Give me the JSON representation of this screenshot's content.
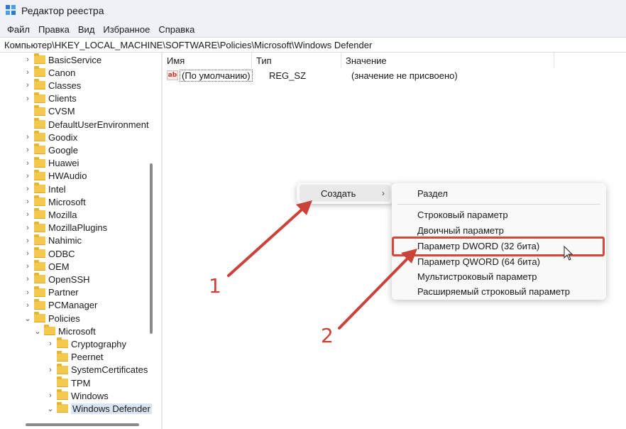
{
  "window": {
    "title": "Редактор реестра"
  },
  "menu": [
    "Файл",
    "Правка",
    "Вид",
    "Избранное",
    "Справка"
  ],
  "address": "Компьютер\\HKEY_LOCAL_MACHINE\\SOFTWARE\\Policies\\Microsoft\\Windows Defender",
  "tree": {
    "level1": [
      {
        "label": "BasicService",
        "expandable": true
      },
      {
        "label": "Canon",
        "expandable": true
      },
      {
        "label": "Classes",
        "expandable": true
      },
      {
        "label": "Clients",
        "expandable": true
      },
      {
        "label": "CVSM",
        "expandable": false
      },
      {
        "label": "DefaultUserEnvironment",
        "expandable": false
      },
      {
        "label": "Goodix",
        "expandable": true
      },
      {
        "label": "Google",
        "expandable": true
      },
      {
        "label": "Huawei",
        "expandable": true
      },
      {
        "label": "HWAudio",
        "expandable": true
      },
      {
        "label": "Intel",
        "expandable": true
      },
      {
        "label": "Microsoft",
        "expandable": true
      },
      {
        "label": "Mozilla",
        "expandable": true
      },
      {
        "label": "MozillaPlugins",
        "expandable": true
      },
      {
        "label": "Nahimic",
        "expandable": true
      },
      {
        "label": "ODBC",
        "expandable": true
      },
      {
        "label": "OEM",
        "expandable": true
      },
      {
        "label": "OpenSSH",
        "expandable": true
      },
      {
        "label": "Partner",
        "expandable": true
      },
      {
        "label": "PCManager",
        "expandable": true
      },
      {
        "label": "Policies",
        "expandable": true,
        "expanded": true
      }
    ],
    "level2": [
      {
        "label": "Microsoft",
        "expanded": true
      }
    ],
    "level3": [
      {
        "label": "Cryptography",
        "expandable": true
      },
      {
        "label": "Peernet",
        "expandable": false
      },
      {
        "label": "SystemCertificates",
        "expandable": true
      },
      {
        "label": "TPM",
        "expandable": false
      },
      {
        "label": "Windows",
        "expandable": true
      },
      {
        "label": "Windows Defender",
        "expandable": true,
        "expanded": true,
        "selected": true
      }
    ]
  },
  "list": {
    "columns": [
      "Имя",
      "Тип",
      "Значение"
    ],
    "rows": [
      {
        "icon": "string-value-icon",
        "icon_text": "ab",
        "name": "(По умолчанию)",
        "type": "REG_SZ",
        "value": "(значение не присвоено)"
      }
    ]
  },
  "context_menu": {
    "item": "Создать",
    "arrow": "›",
    "submenu": [
      "Раздел",
      "Строковый параметр",
      "Двоичный параметр",
      "Параметр DWORD (32 бита)",
      "Параметр QWORD (64 бита)",
      "Мультистроковый параметр",
      "Расширяемый строковый параметр"
    ],
    "highlighted": "Параметр DWORD (32 бита)"
  },
  "annotations": {
    "step1": "1",
    "step2": "2",
    "color": "#c9433a"
  }
}
